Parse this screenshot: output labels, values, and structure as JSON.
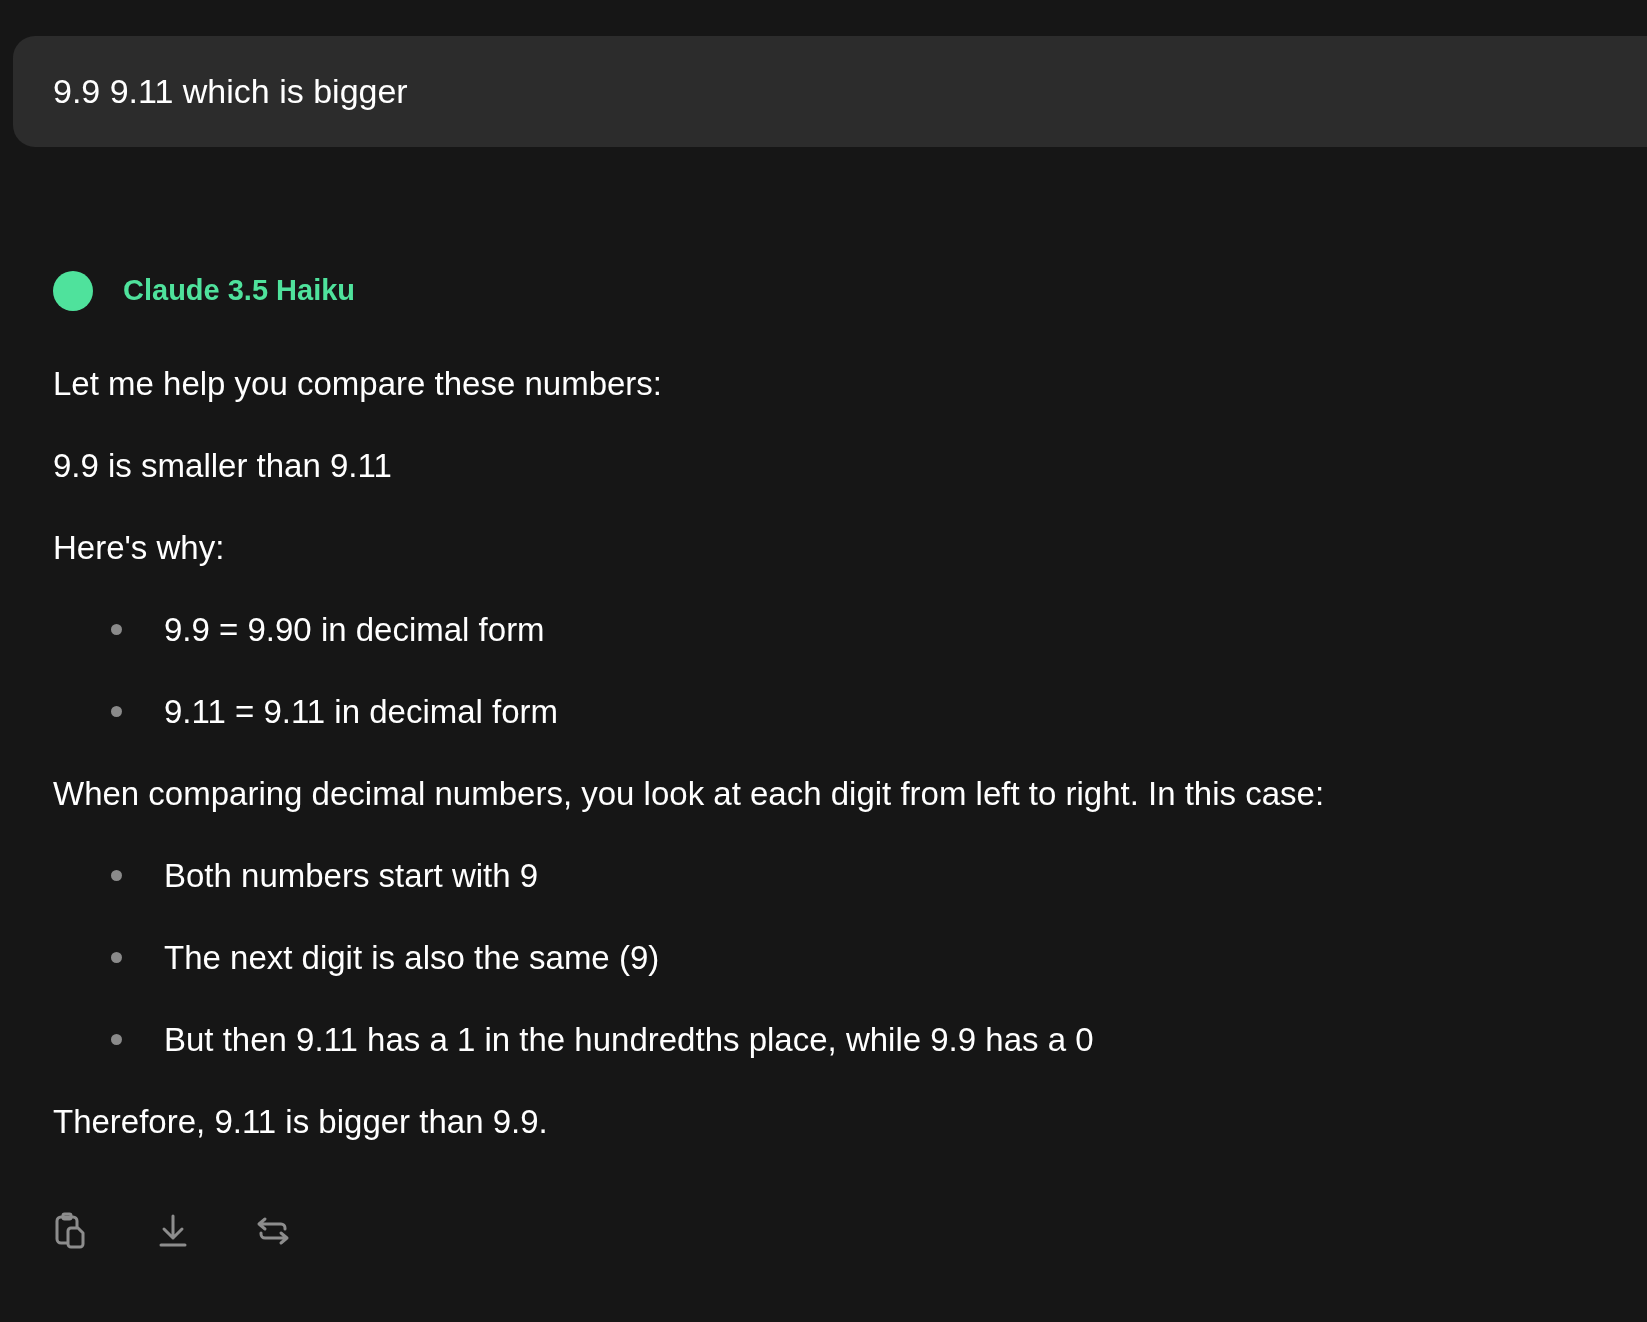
{
  "user_message": {
    "text": "9.9 9.11 which is bigger"
  },
  "assistant": {
    "model_name": "Claude 3.5 Haiku",
    "blocks": [
      {
        "kind": "paragraph",
        "text": "Let me help you compare these numbers:"
      },
      {
        "kind": "paragraph",
        "text": "9.9 is smaller than 9.11"
      },
      {
        "kind": "paragraph",
        "text": "Here's why:"
      },
      {
        "kind": "list",
        "items": [
          "9.9 = 9.90 in decimal form",
          "9.11 = 9.11 in decimal form"
        ]
      },
      {
        "kind": "paragraph",
        "text": "When comparing decimal numbers, you look at each digit from left to right. In this case:"
      },
      {
        "kind": "list",
        "items": [
          "Both numbers start with 9",
          "The next digit is also the same (9)",
          "But then 9.11 has a 1 in the hundredths place, while 9.9 has a 0"
        ]
      },
      {
        "kind": "paragraph",
        "text": "Therefore, 9.11 is bigger than 9.9."
      }
    ]
  }
}
